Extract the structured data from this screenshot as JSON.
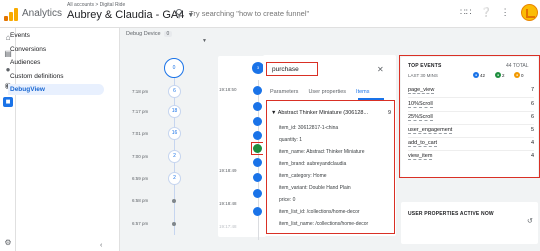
{
  "topbar": {
    "app_title": "Analytics",
    "breadcrumb": "All accounts > Digital Ride",
    "account_name": "Aubrey & Claudia - GA4",
    "search_placeholder": "Try searching \"how to create funnel\""
  },
  "nav": {
    "items": [
      {
        "label": "Events",
        "active": false
      },
      {
        "label": "Conversions",
        "active": false
      },
      {
        "label": "Audiences",
        "active": false
      },
      {
        "label": "Custom definitions",
        "active": false
      },
      {
        "label": "DebugView",
        "active": true
      }
    ]
  },
  "debug": {
    "device_label": "Debug Device",
    "device_count": "0",
    "minutes": [
      {
        "time": "",
        "count": "0"
      },
      {
        "time": "7:18 pm",
        "count": "6"
      },
      {
        "time": "7:17 pm",
        "count": "18"
      },
      {
        "time": "7:01 pm",
        "count": "16"
      },
      {
        "time": "7:00 pm",
        "count": "2"
      },
      {
        "time": "6:59 pm",
        "count": "2"
      },
      {
        "time": "6:58 pm",
        "count": ""
      },
      {
        "time": "6:57 pm",
        "count": ""
      }
    ],
    "seconds": [
      {
        "time": "19:18:50"
      },
      {
        "time": "19:18:49"
      },
      {
        "time": "19:18:48"
      },
      {
        "time": "19:17:48"
      }
    ],
    "top_badge": "3"
  },
  "event_panel": {
    "event_name": "purchase",
    "tabs": [
      "Parameters",
      "User properties",
      "Items"
    ],
    "selected_tab": "Items",
    "item_title": "Abstract Thinker Miniature (306128...",
    "item_count": "9",
    "params": [
      "item_id: 30612817-1-china",
      "quantity: 1",
      "item_name: Abstract Thinker Miniature",
      "item_brand: aubreyandclaudia",
      "item_category: Home",
      "item_variant: Double Hand Plain",
      "price: 0",
      "item_list_id: /collections/home-decor",
      "item_list_name: /collections/home-decor"
    ]
  },
  "top_events": {
    "title": "TOP EVENTS",
    "total": "44 TOTAL",
    "period": "LAST 30 MINS",
    "badges": [
      {
        "value": "42",
        "color": "#1a73e8",
        "icon": "conversion-icon"
      },
      {
        "value": "2",
        "color": "#1e8e3e",
        "icon": "flag-icon"
      },
      {
        "value": "0",
        "color": "#f29900",
        "icon": "error-icon"
      }
    ],
    "events": [
      {
        "name": "page_view",
        "count": "7"
      },
      {
        "name": "10%Scroll",
        "count": "6"
      },
      {
        "name": "25%Scroll",
        "count": "6"
      },
      {
        "name": "user_engagement",
        "count": "5"
      },
      {
        "name": "add_to_cart",
        "count": "4"
      },
      {
        "name": "view_item",
        "count": "4"
      }
    ]
  },
  "user_props": {
    "title": "USER PROPERTIES ACTIVE NOW"
  }
}
